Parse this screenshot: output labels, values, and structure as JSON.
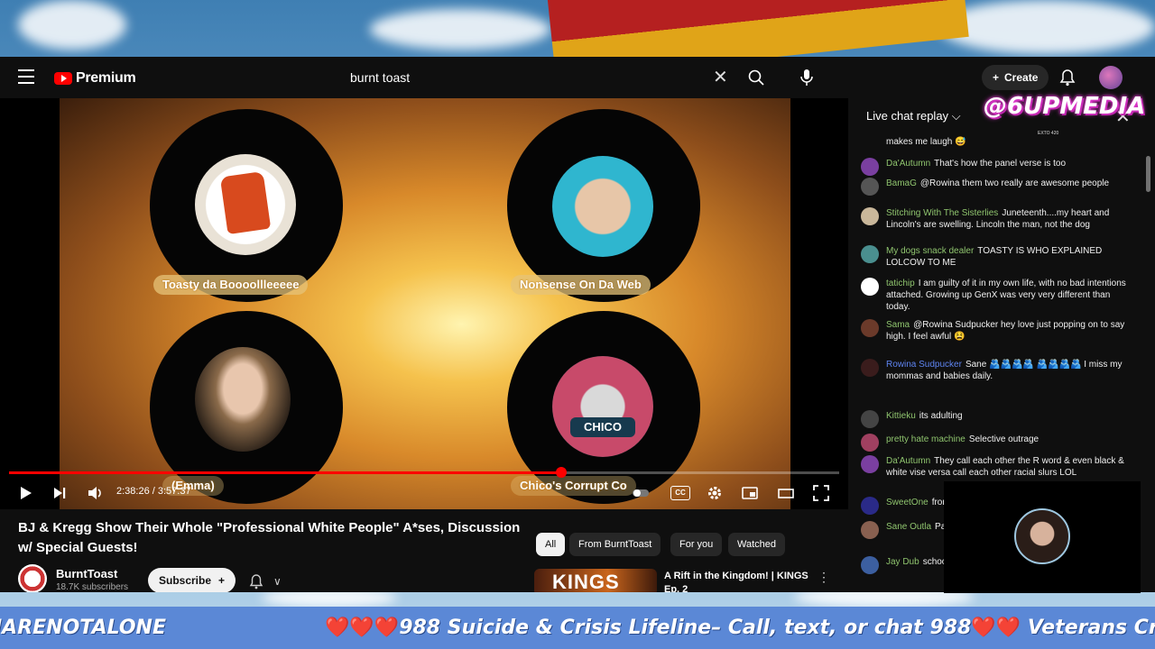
{
  "app": {
    "brand": "Premium",
    "search_value": "burnt toast",
    "create_label": "Create"
  },
  "video": {
    "participants": [
      {
        "name": "Toasty da Boooollleeeee"
      },
      {
        "name": "Nonsense On Da Web"
      },
      {
        "name": "(Emma)"
      },
      {
        "name": "Chico's Corrupt Co"
      }
    ],
    "chico_label": "CHICO",
    "time": "2:38:26 / 3:57:37",
    "progress": 0.665,
    "cc_label": "CC"
  },
  "info": {
    "title": "BJ & Kregg Show Their Whole \"Professional White People\" A*ses, Discussion w/ Special Guests!",
    "channel": "BurntToast",
    "subscribers": "18.7K subscribers",
    "subscribe_label": "Subscribe"
  },
  "chips": [
    "All",
    "From BurntToast",
    "For you",
    "Watched"
  ],
  "recommended": {
    "thumb_text": "KINGS",
    "title": "A Rift in the Kingdom! | KINGS Ep. 2"
  },
  "chat": {
    "header": "Live chat replay",
    "messages": [
      {
        "author": "",
        "text": "makes me laugh 😅"
      },
      {
        "author": "Da'Autumn",
        "text": "That's how the panel verse is too"
      },
      {
        "author": "BamaG",
        "text": "@Rowina them two really are awesome people"
      },
      {
        "author": "Stitching With The Sisterlies",
        "text": "Juneteenth....my heart and Lincoln's are swelling. Lincoln the man, not the dog"
      },
      {
        "author": "My dogs snack dealer",
        "text": "TOASTY IS WHO EXPLAINED LOLCOW TO ME"
      },
      {
        "author": "tatichip",
        "text": "I am guilty of it in my own life, with no bad intentions attached. Growing up GenX was very very different than today."
      },
      {
        "author": "Sama",
        "text": "@Rowina Sudpucker hey love just popping on to say high. I feel awful 😫"
      },
      {
        "author": "Rowina Sudpucker",
        "text": "Sane 🫂🫂🫂🫂 🫂🫂🫂🫂 I miss my mommas and babies daily."
      },
      {
        "author": "Kittieku",
        "text": "its adulting"
      },
      {
        "author": "pretty hate machine",
        "text": "Selective outrage"
      },
      {
        "author": "Da'Autumn",
        "text": "They call each other the R word & even black & white vise versa call each other racial slurs LOL"
      },
      {
        "author": "SweetOne",
        "text": "from. We ar"
      },
      {
        "author": "Sane Outla",
        "text": "Patriot rabb"
      },
      {
        "author": "Jay Dub",
        "text": "schooling B"
      }
    ]
  },
  "overlay": {
    "watermark": "@6UPMEDIA",
    "watermark_sub": "EXTO 420"
  },
  "ticker": {
    "left": "JARENOTALONE",
    "hearts": "❤️❤️❤️",
    "main": "988 Suicide & Crisis Lifeline– Call, text, or chat 988",
    "hearts2": "❤️❤️",
    "tail": " Veterans Crisi"
  },
  "colors": {
    "accent": "#ff0000",
    "ticker_bg": "#5b88d6",
    "watermark": "#e23bd0"
  }
}
